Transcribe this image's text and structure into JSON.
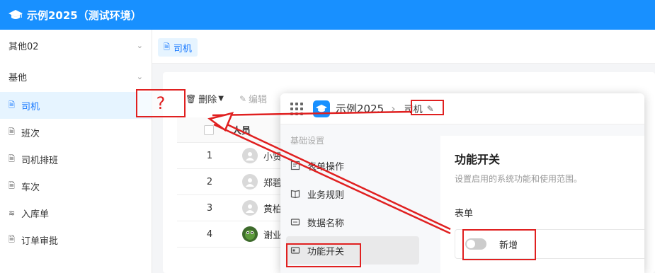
{
  "app": {
    "title": "示例2025（测试环境）",
    "brand_color": "#1890ff"
  },
  "sidebar": {
    "groups": [
      {
        "label": "其他02"
      },
      {
        "label": "基他"
      }
    ],
    "items": [
      {
        "label": "司机",
        "icon": "document-icon",
        "active": true
      },
      {
        "label": "班次",
        "icon": "document-icon"
      },
      {
        "label": "司机排班",
        "icon": "document-icon"
      },
      {
        "label": "车次",
        "icon": "document-icon"
      },
      {
        "label": "入库单",
        "icon": "hierarchy-icon"
      },
      {
        "label": "订单审批",
        "icon": "document-icon"
      }
    ]
  },
  "tabs": [
    {
      "label": "司机"
    }
  ],
  "toolbar": {
    "delete_label": "删除",
    "edit_label": "编辑"
  },
  "table": {
    "header_user": "人员",
    "rows": [
      {
        "index": "1",
        "name": "小贤"
      },
      {
        "index": "2",
        "name": "郑碧琪"
      },
      {
        "index": "3",
        "name": "黄柏燃"
      },
      {
        "index": "4",
        "name": "谢业俊"
      }
    ]
  },
  "overlay": {
    "app_name": "示例2025",
    "breadcrumb": "司机",
    "nav_section": "基础设置",
    "nav_items": [
      {
        "label": "表单操作"
      },
      {
        "label": "业务规则"
      },
      {
        "label": "数据名称"
      },
      {
        "label": "功能开关",
        "active": true
      }
    ],
    "heading": "功能开关",
    "description": "设置启用的系统功能和使用范围。",
    "form_label": "表单",
    "switch_label": "新增",
    "switch_on": false
  },
  "annotation": {
    "question_mark": "?",
    "color": "#e02020"
  }
}
